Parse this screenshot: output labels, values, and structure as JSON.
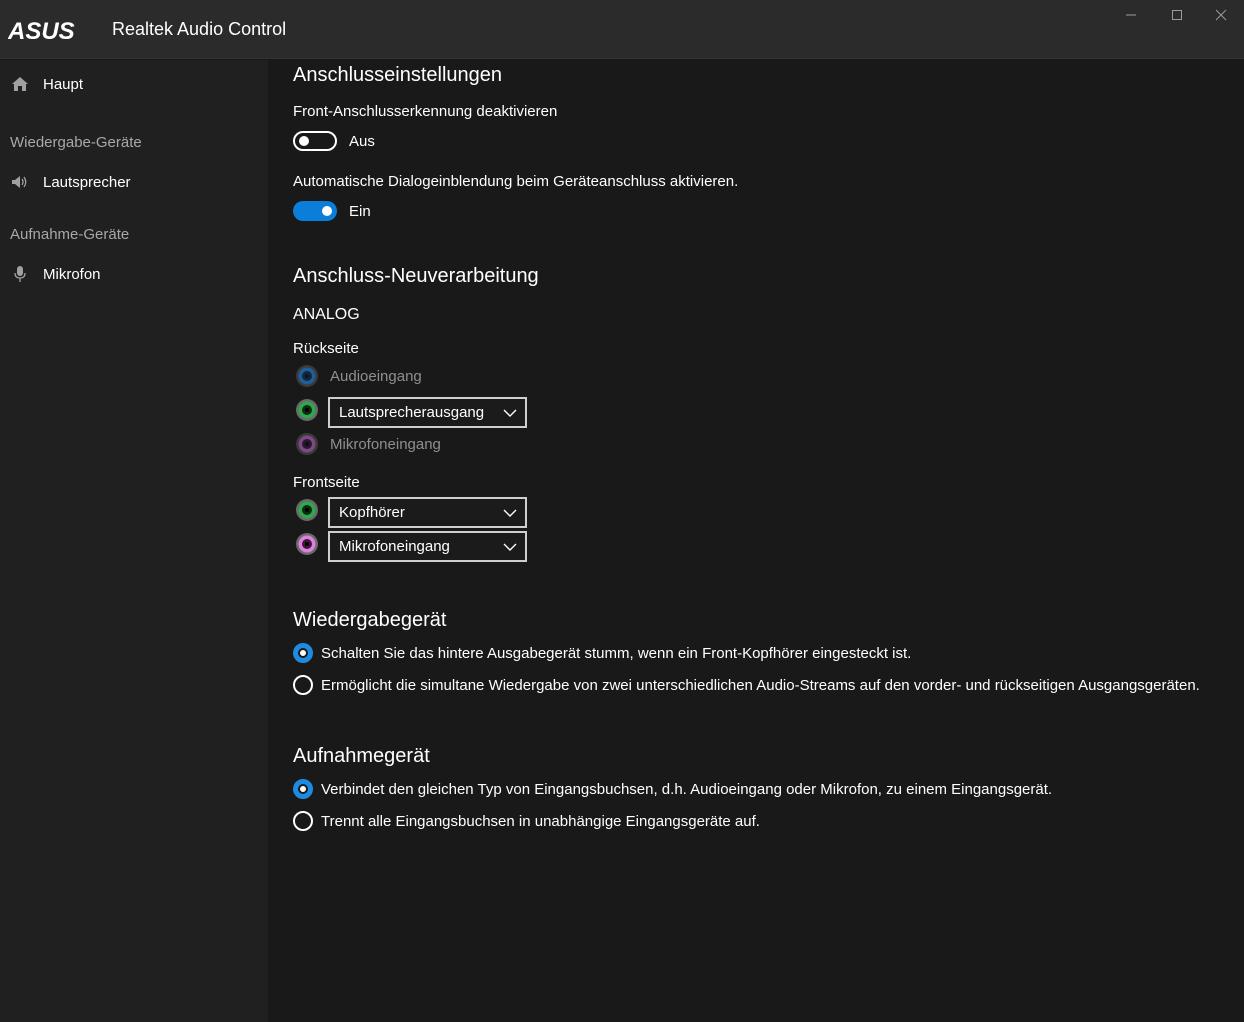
{
  "app": {
    "logo_text": "ASUS",
    "title": "Realtek Audio Control"
  },
  "window_controls": {
    "minimize": "minimize-icon",
    "maximize": "maximize-icon",
    "close": "close-icon"
  },
  "sidebar": {
    "main_item": {
      "label": "Haupt",
      "icon": "home-icon"
    },
    "playback_section": "Wiedergabe-Geräte",
    "playback_item": {
      "label": "Lautsprecher",
      "icon": "speaker-icon"
    },
    "recording_section": "Aufnahme-Geräte",
    "recording_item": {
      "label": "Mikrofon",
      "icon": "microphone-icon"
    }
  },
  "connector_settings": {
    "heading": "Anschlusseinstellungen",
    "front_detect": {
      "label": "Front-Anschlusserkennung deaktivieren",
      "state_label": "Aus",
      "on": false
    },
    "auto_popup": {
      "label": "Automatische Dialogeinblendung beim Geräteanschluss aktivieren.",
      "state_label": "Ein",
      "on": true
    }
  },
  "retasking": {
    "heading": "Anschluss-Neuverarbeitung",
    "analog_label": "ANALOG",
    "rear": {
      "label": "Rückseite",
      "jacks": [
        {
          "color": "#1e6fb8",
          "text": "Audioeingang",
          "enabled": false
        },
        {
          "color": "#2ea84a",
          "text": "Lautsprecherausgang",
          "enabled": true
        },
        {
          "color": "#a05aa8",
          "text": "Mikrofoneingang",
          "enabled": false
        }
      ]
    },
    "front": {
      "label": "Frontseite",
      "jacks": [
        {
          "color": "#2ea84a",
          "text": "Kopfhörer",
          "enabled": true
        },
        {
          "color": "#e07fe0",
          "text": "Mikrofoneingang",
          "enabled": true
        }
      ]
    }
  },
  "playback_device": {
    "heading": "Wiedergabegerät",
    "options": [
      {
        "label": "Schalten Sie das hintere Ausgabegerät stumm, wenn ein Front-Kopfhörer eingesteckt ist.",
        "selected": true
      },
      {
        "label": "Ermöglicht die simultane Wiedergabe von zwei unterschiedlichen Audio-Streams auf den vorder- und rückseitigen Ausgangsgeräten.",
        "selected": false
      }
    ]
  },
  "recording_device": {
    "heading": "Aufnahmegerät",
    "options": [
      {
        "label": "Verbindet den gleichen Typ von Eingangsbuchsen, d.h. Audioeingang oder Mikrofon, zu einem Eingangsgerät.",
        "selected": true
      },
      {
        "label": "Trennt alle Eingangsbuchsen in unabhängige Eingangsgeräte auf.",
        "selected": false
      }
    ]
  },
  "colors": {
    "accent": "#0a7ed8",
    "sidebar_bg": "#202020",
    "main_bg": "#191919",
    "titlebar_bg": "#2b2b2b"
  }
}
